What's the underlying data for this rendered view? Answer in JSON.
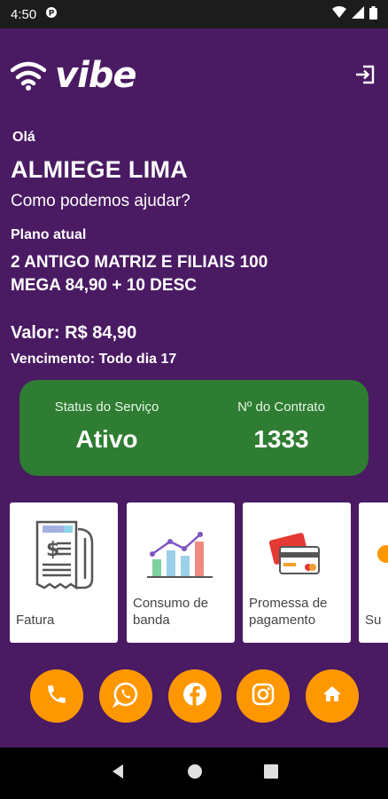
{
  "status_bar": {
    "time": "4:50"
  },
  "header": {
    "app_name": "vibe"
  },
  "greeting": "Olá",
  "user": {
    "name": "ALMIEGE LIMA"
  },
  "help_text": "Como podemos ajudar?",
  "plan": {
    "label": "Plano atual",
    "name": "2 ANTIGO MATRIZ E FILIAIS 100 MEGA 84,90 + 10 DESC",
    "price": "Valor: R$ 84,90",
    "due": "Vencimento: Todo dia 17"
  },
  "status_card": {
    "service_label": "Status do Serviço",
    "service_value": "Ativo",
    "contract_label": "Nº do Contrato",
    "contract_value": "1333"
  },
  "tiles": [
    {
      "label": "Fatura",
      "icon": "invoice-icon"
    },
    {
      "label": "Consumo de banda",
      "icon": "bandwidth-chart-icon"
    },
    {
      "label": "Promessa de pagamento",
      "icon": "credit-card-icon"
    },
    {
      "label": "Su",
      "icon": "support-icon"
    }
  ],
  "social_buttons": [
    "phone-icon",
    "whatsapp-icon",
    "facebook-icon",
    "instagram-icon",
    "home-icon"
  ],
  "colors": {
    "background": "#4a1a63",
    "status_green": "#2e7d32",
    "accent_orange": "#ff9800"
  }
}
